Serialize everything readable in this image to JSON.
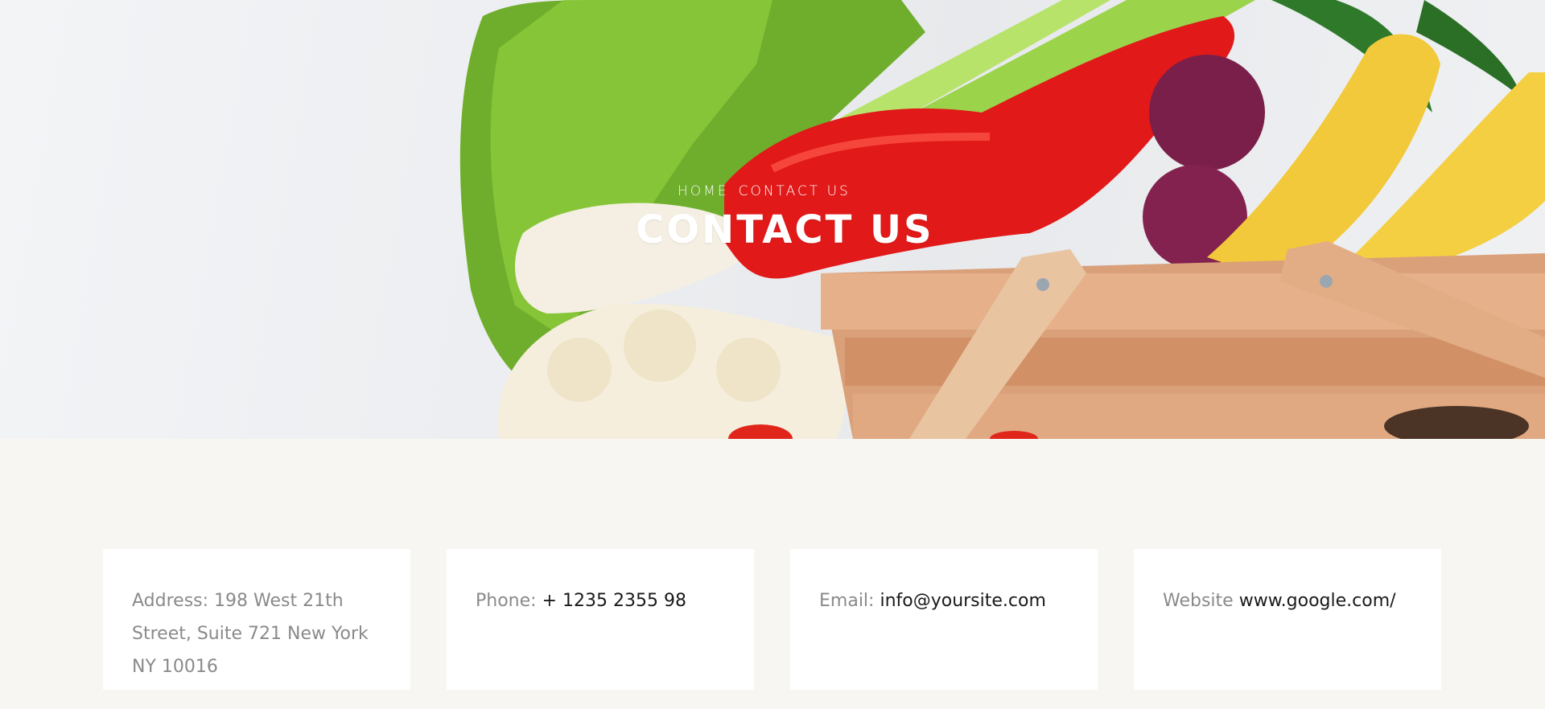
{
  "hero": {
    "breadcrumbs": [
      {
        "label": "Home"
      },
      {
        "label": "Contact Us"
      }
    ],
    "title": "CONTACT US"
  },
  "cards": [
    {
      "label": "Address:",
      "value": "198 West 21th Street, Suite 721 New York NY 10016"
    },
    {
      "label": "Phone:",
      "value": "+ 1235 2355 98"
    },
    {
      "label": "Email:",
      "value": "info@yoursite.com"
    },
    {
      "label": "Website",
      "value": "www.google.com/"
    }
  ],
  "colors": {
    "page_bg": "#f7f6f2",
    "card_bg": "#ffffff",
    "label_text": "#8a8a8a",
    "value_text": "#1a1a1a"
  }
}
